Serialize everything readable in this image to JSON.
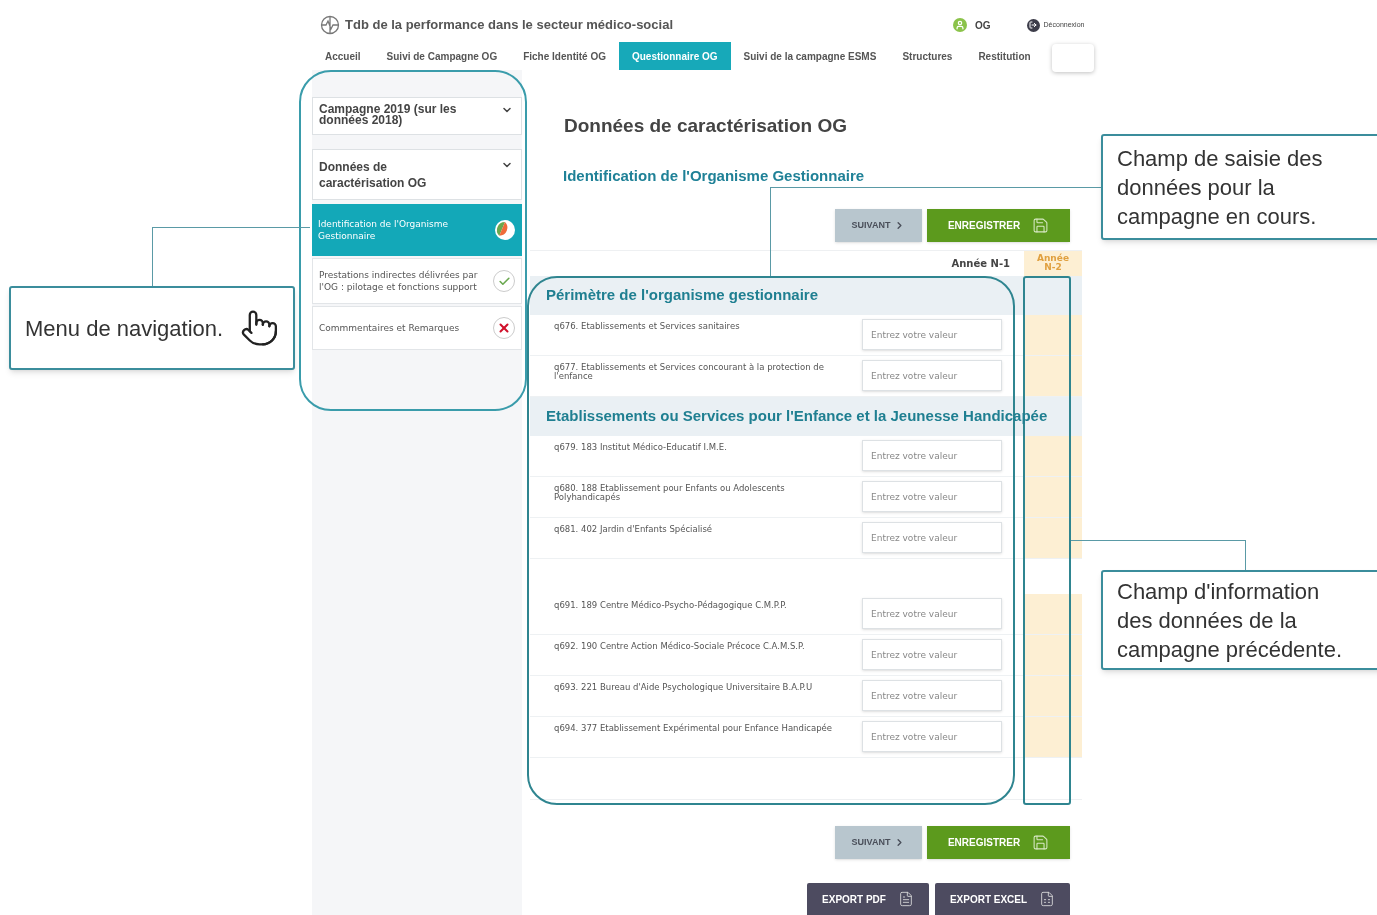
{
  "header": {
    "title": "Tdb de la performance dans le secteur médico-social",
    "user": "OG",
    "logout": "Déconnexion"
  },
  "nav_tabs": [
    {
      "label": "Accueil",
      "selected": false
    },
    {
      "label": "Suivi de Campagne OG",
      "selected": false
    },
    {
      "label": "Fiche Identité OG",
      "selected": false
    },
    {
      "label": "Questionnaire OG",
      "selected": true
    },
    {
      "label": "Suivi de la campagne ESMS",
      "selected": false
    },
    {
      "label": "Structures",
      "selected": false
    },
    {
      "label": "Restitution",
      "selected": false
    }
  ],
  "sidebar": {
    "campaign": "Campagne 2019 (sur les données 2018)",
    "section": "Données de caractérisation OG",
    "items": [
      {
        "label": "Identification de l'Organisme Gestionnaire",
        "selected": true,
        "kind": "partial"
      },
      {
        "label": "Prestations indirectes délivrées par l'OG : pilotage et fonctions support",
        "selected": false,
        "kind": "complete"
      },
      {
        "label": "Commmentaires et Remarques",
        "selected": false,
        "kind": "error"
      }
    ]
  },
  "main": {
    "title": "Données de caractérisation OG",
    "subtitle": "Identification de l'Organisme Gestionnaire",
    "buttons_top": [
      {
        "label": "SUIVANT",
        "kind": "next"
      },
      {
        "label": "ENREGISTRER",
        "kind": "save"
      }
    ],
    "column_n1": "Année N-1",
    "column_n2": "Année N-2",
    "sections": [
      {
        "title": "Périmètre de l'organisme gestionnaire",
        "rows": [
          {
            "label": "q676. Etablissements et Services sanitaires",
            "placeholder": "Entrez votre valeur"
          },
          {
            "label": "q677. Etablissements et Services concourant à la protection de l'enfance",
            "placeholder": "Entrez votre valeur"
          }
        ]
      },
      {
        "title": "Etablissements ou Services pour l'Enfance et la Jeunesse Handicapée",
        "rows": [
          {
            "label": "q679. 183 Institut Médico-Educatif I.M.E.",
            "placeholder": "Entrez votre valeur"
          },
          {
            "label": "q680. 188 Etablissement pour Enfants ou Adolescents Polyhandicapés",
            "placeholder": "Entrez votre valeur"
          },
          {
            "label": "q681. 402 Jardin d'Enfants Spécialisé",
            "placeholder": "Entrez votre valeur"
          }
        ]
      },
      {
        "rows": [
          {
            "label": "q691. 189 Centre Médico-Psycho-Pédagogique C.M.P.P.",
            "placeholder": "Entrez votre valeur"
          },
          {
            "label": "q692. 190 Centre Action Médico-Sociale Précoce C.A.M.S.P.",
            "placeholder": "Entrez votre valeur"
          },
          {
            "label": "q693. 221 Bureau d'Aide Psychologique Universitaire B.A.P.U",
            "placeholder": "Entrez votre valeur"
          },
          {
            "label": "q694. 377 Etablissement Expérimental pour Enfance Handicapée",
            "placeholder": "Entrez votre valeur"
          }
        ]
      }
    ],
    "buttons_bottom": [
      {
        "label": "SUIVANT",
        "kind": "next"
      },
      {
        "label": "ENREGISTRER",
        "kind": "save"
      }
    ],
    "exports": [
      {
        "label": "EXPORT PDF",
        "kind": "pdf"
      },
      {
        "label": "EXPORT EXCEL",
        "kind": "excel"
      }
    ]
  },
  "annotations": [
    {
      "text": "Menu de navigation.",
      "kind": "navigation"
    },
    {
      "text": "Champ de saisie des données pour la campagne en cours.",
      "kind": "input"
    },
    {
      "text": "Champ d'information des données de la campagne précédente.",
      "kind": "previous"
    }
  ]
}
